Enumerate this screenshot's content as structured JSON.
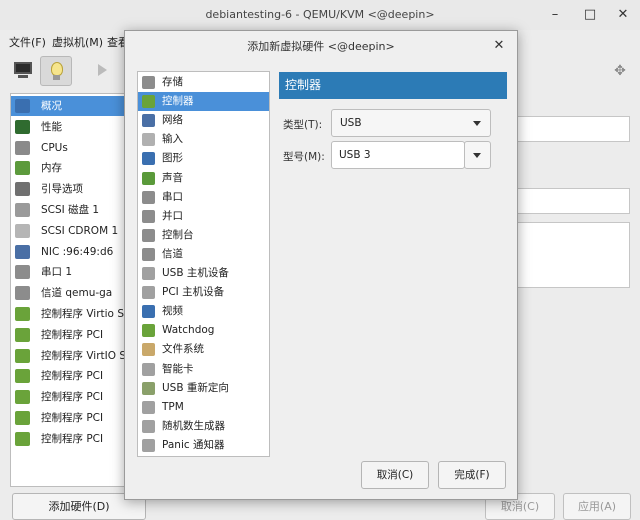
{
  "window": {
    "title": "debiantesting-6 - QEMU/KVM <@deepin>",
    "controls": [
      "–",
      "□",
      "✕"
    ]
  },
  "menubar": [
    "文件(F)",
    "虚拟机(M)",
    "查看"
  ],
  "hw_list": [
    {
      "label": "概况",
      "icon": "overview-icon",
      "color": "#3a6fb0",
      "selected": true
    },
    {
      "label": "性能",
      "icon": "performance-icon",
      "color": "#2f6b2f"
    },
    {
      "label": "CPUs",
      "icon": "cpu-icon",
      "color": "#8a8a8a"
    },
    {
      "label": "内存",
      "icon": "memory-icon",
      "color": "#5c9a3c"
    },
    {
      "label": "引导选项",
      "icon": "boot-icon",
      "color": "#707070"
    },
    {
      "label": "SCSI 磁盘 1",
      "icon": "disk-icon",
      "color": "#9a9a9a"
    },
    {
      "label": "SCSI CDROM 1",
      "icon": "cdrom-icon",
      "color": "#b5b5b5"
    },
    {
      "label": "NIC :96:49:d6",
      "icon": "nic-icon",
      "color": "#4a6fa5"
    },
    {
      "label": "串口 1",
      "icon": "serial-icon",
      "color": "#8c8c8c"
    },
    {
      "label": "信道 qemu-ga",
      "icon": "channel-icon",
      "color": "#8c8c8c"
    },
    {
      "label": "控制程序 Virtio SCSI",
      "icon": "controller-icon",
      "color": "#6aa33a"
    },
    {
      "label": "控制程序 PCI",
      "icon": "controller-icon",
      "color": "#6aa33a"
    },
    {
      "label": "控制程序 VirtIO Serial",
      "icon": "controller-icon",
      "color": "#6aa33a"
    },
    {
      "label": "控制程序 PCI",
      "icon": "controller-icon",
      "color": "#6aa33a"
    },
    {
      "label": "控制程序 PCI",
      "icon": "controller-icon",
      "color": "#6aa33a"
    },
    {
      "label": "控制程序 PCI",
      "icon": "controller-icon",
      "color": "#6aa33a"
    },
    {
      "label": "控制程序 PCI",
      "icon": "controller-icon",
      "color": "#6aa33a"
    }
  ],
  "add_hardware_button": "添加硬件(D)",
  "bg_buttons": {
    "cancel": "取消(C)",
    "apply": "应用(A)"
  },
  "dialog": {
    "title": "添加新虚拟硬件 <@deepin>",
    "close": "✕",
    "types": [
      {
        "label": "存储",
        "icon": "storage-icon",
        "color": "#8c8c8c"
      },
      {
        "label": "控制器",
        "icon": "controller-icon",
        "color": "#6aa33a",
        "selected": true
      },
      {
        "label": "网络",
        "icon": "network-icon",
        "color": "#4a6fa5"
      },
      {
        "label": "输入",
        "icon": "mouse-icon",
        "color": "#b0b0b0"
      },
      {
        "label": "图形",
        "icon": "graphics-icon",
        "color": "#3a6fb0"
      },
      {
        "label": "声音",
        "icon": "sound-icon",
        "color": "#5a9a3a"
      },
      {
        "label": "串口",
        "icon": "serial-icon",
        "color": "#8c8c8c"
      },
      {
        "label": "并口",
        "icon": "parallel-icon",
        "color": "#8c8c8c"
      },
      {
        "label": "控制台",
        "icon": "console-icon",
        "color": "#8c8c8c"
      },
      {
        "label": "信道",
        "icon": "channel-icon",
        "color": "#8c8c8c"
      },
      {
        "label": "USB 主机设备",
        "icon": "usb-host-icon",
        "color": "#a0a0a0"
      },
      {
        "label": "PCI 主机设备",
        "icon": "pci-host-icon",
        "color": "#a0a0a0"
      },
      {
        "label": "视频",
        "icon": "video-icon",
        "color": "#3a6fb0"
      },
      {
        "label": "Watchdog",
        "icon": "watchdog-icon",
        "color": "#6aa33a"
      },
      {
        "label": "文件系统",
        "icon": "filesystem-icon",
        "color": "#c9a86a"
      },
      {
        "label": "智能卡",
        "icon": "smartcard-icon",
        "color": "#a0a0a0"
      },
      {
        "label": "USB 重新定向",
        "icon": "usb-redirect-icon",
        "color": "#8aa06a"
      },
      {
        "label": "TPM",
        "icon": "tpm-icon",
        "color": "#a0a0a0"
      },
      {
        "label": "随机数生成器",
        "icon": "rng-icon",
        "color": "#a0a0a0"
      },
      {
        "label": "Panic 通知器",
        "icon": "panic-icon",
        "color": "#a0a0a0"
      }
    ],
    "panel_title": "控制器",
    "type_label": "类型(T):",
    "type_value": "USB",
    "model_label": "型号(M):",
    "model_value": "USB 3",
    "cancel_button": "取消(C)",
    "finish_button": "完成(F)"
  },
  "colors": {
    "selection": "#4a90d9",
    "panel_header": "#2c7bb6"
  }
}
